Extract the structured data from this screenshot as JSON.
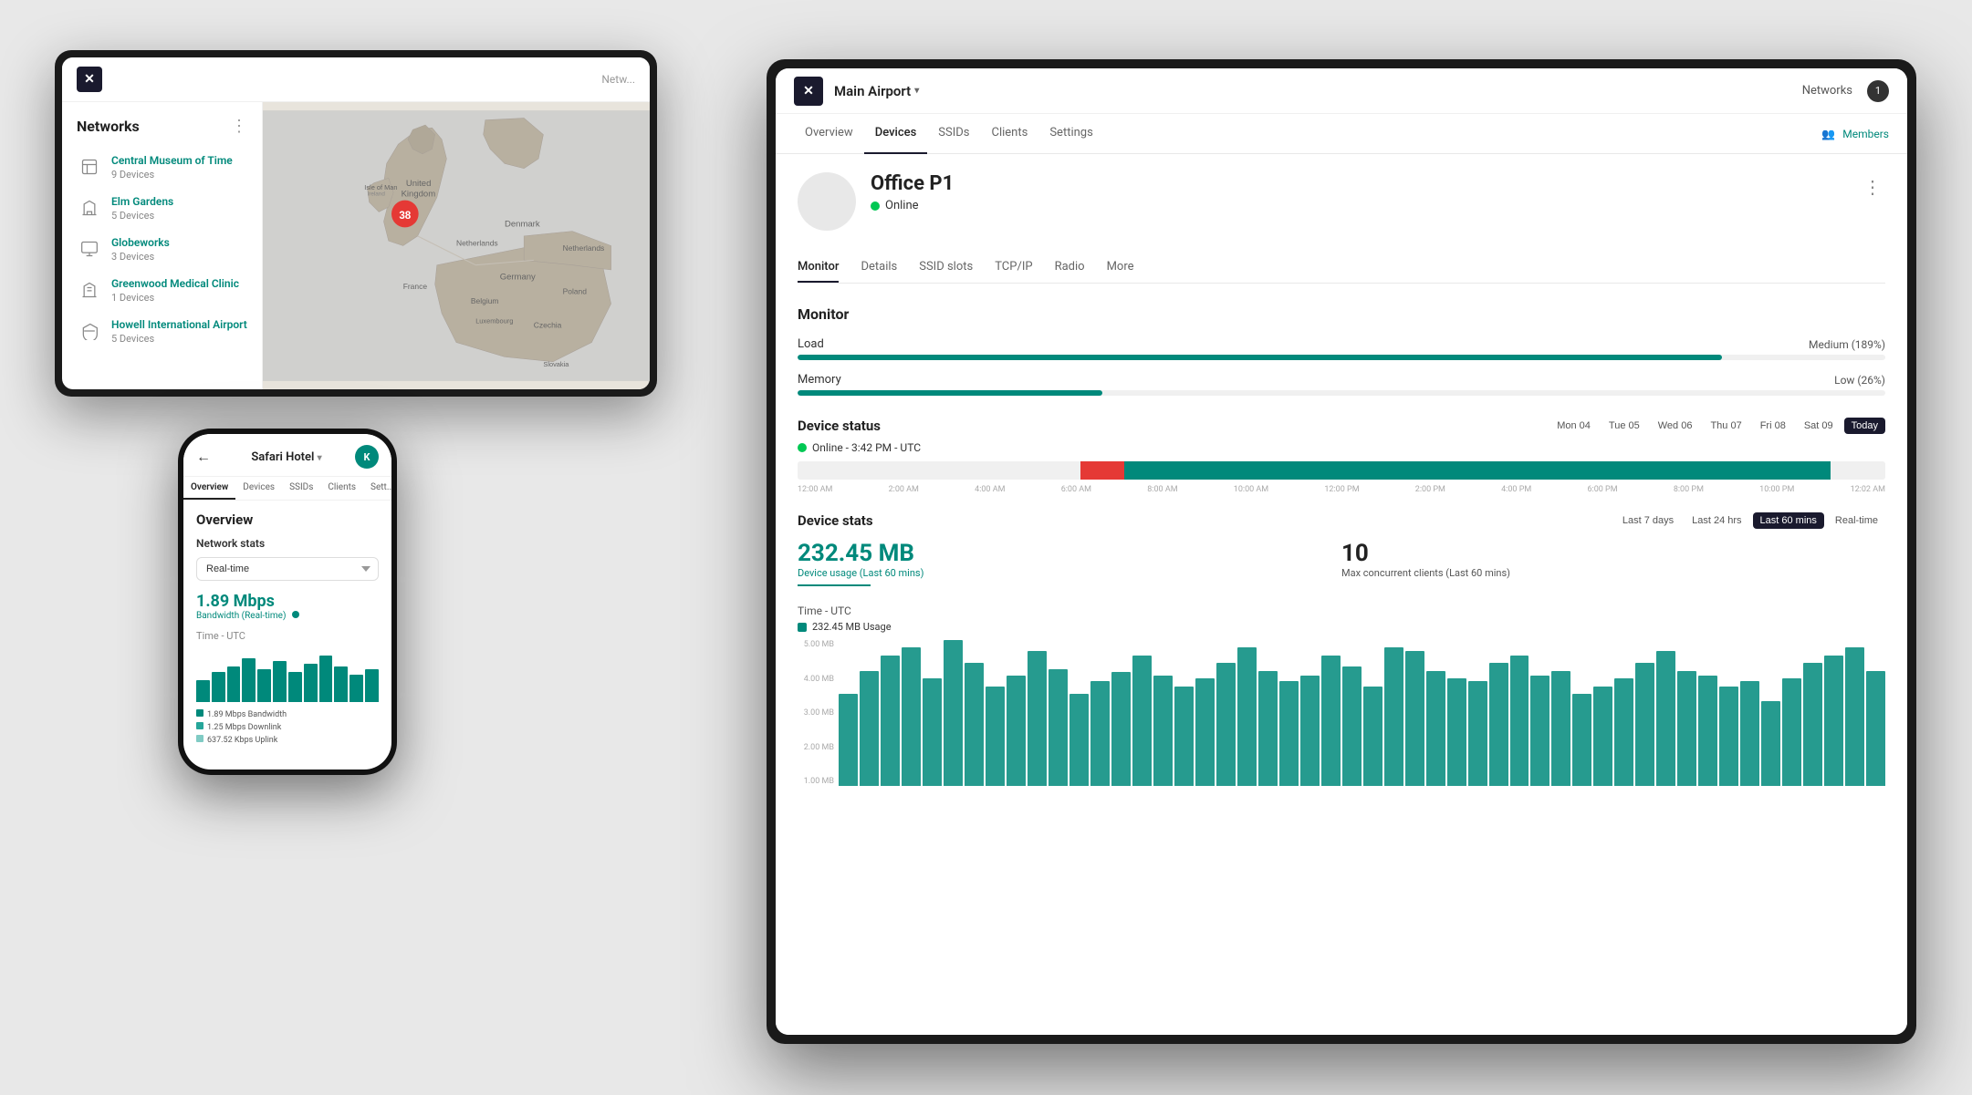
{
  "left_tablet": {
    "logo": "✕",
    "header": {
      "title": "Networks",
      "nav_right": "Netw..."
    },
    "networks": [
      {
        "name": "Central Museum of Time",
        "devices": "9 Devices",
        "icon": "🏛"
      },
      {
        "name": "Elm Gardens",
        "devices": "5 Devices",
        "icon": "🌳"
      },
      {
        "name": "Globeworks",
        "devices": "3 Devices",
        "icon": "🏢"
      },
      {
        "name": "Greenwood Medical Clinic",
        "devices": "1 Devices",
        "icon": "🏥"
      },
      {
        "name": "Howell International Airport",
        "devices": "5 Devices",
        "icon": "✈"
      }
    ],
    "map_pin_count": "38"
  },
  "phone": {
    "header": {
      "back": "←",
      "title": "Safari Hotel",
      "avatar": "K"
    },
    "nav": [
      "Overview",
      "Devices",
      "SSIDs",
      "Clients",
      "Sett..."
    ],
    "active_nav": "Overview",
    "content": {
      "title": "Overview",
      "section": "Network stats",
      "dropdown": "Real-time",
      "bandwidth_value": "1.89 Mbps",
      "bandwidth_label": "Bandwidth (Real-time)",
      "time_label": "Time - UTC",
      "legend": [
        {
          "color": "#00897b",
          "label": "1.89 Mbps Bandwidth"
        },
        {
          "color": "#26a69a",
          "label": "1.25 Mbps Downlink"
        },
        {
          "color": "#80cbc4",
          "label": "637.52 Kbps Uplink"
        }
      ]
    }
  },
  "right_tablet": {
    "logo": "✕",
    "header": {
      "title": "Main Airport",
      "nav_links": [
        "Networks",
        "1"
      ]
    },
    "nav": [
      "Overview",
      "Devices",
      "SSIDs",
      "Clients",
      "Settings"
    ],
    "active_nav": "Overview",
    "members_label": "Members",
    "device": {
      "name": "Office P1",
      "status": "Online",
      "tabs": [
        "Monitor",
        "Details",
        "SSID slots",
        "TCP/IP",
        "Radio",
        "More"
      ],
      "active_tab": "Monitor"
    },
    "monitor": {
      "title": "Monitor",
      "load": {
        "label": "Load",
        "value": "Medium (189%)",
        "percent": 85
      },
      "memory": {
        "label": "Memory",
        "value": "Low (26%)",
        "percent": 28
      }
    },
    "device_status": {
      "title": "Device status",
      "days": [
        "Mon 04",
        "Tue 05",
        "Wed 06",
        "Thu 07",
        "Fri 08",
        "Sat 09",
        "Today"
      ],
      "active_day": "Today",
      "online_text": "Online - 3:42 PM - UTC",
      "timeline_labels": [
        "12:00 AM",
        "2:00 AM",
        "4:00 AM",
        "6:00 AM",
        "8:00 AM",
        "10:00 AM",
        "12:00 PM",
        "2:00 PM",
        "4:00 PM",
        "6:00 PM",
        "8:00 PM",
        "10:00 PM",
        "12:02 AM"
      ]
    },
    "device_stats": {
      "title": "Device stats",
      "time_filters": [
        "Last 7 days",
        "Last 24 hrs",
        "Last 60 mins",
        "Real-time"
      ],
      "active_filter": "Last 60 mins",
      "stat1_value": "232.45 MB",
      "stat1_label": "Device usage (Last 60 mins)",
      "stat2_value": "10",
      "stat2_label": "Max concurrent clients (Last 60 mins)"
    },
    "chart": {
      "title": "Time - UTC",
      "legend_label": "232.45 MB Usage",
      "y_labels": [
        "5.00 MB",
        "4.00 MB",
        "3.00 MB",
        "2.00 MB",
        "1.00 MB"
      ],
      "bars": [
        60,
        75,
        85,
        90,
        70,
        95,
        80,
        65,
        72,
        88,
        76,
        60,
        68,
        74,
        85,
        72,
        65,
        70,
        80,
        90,
        75,
        68,
        72,
        85,
        78,
        65,
        90,
        88,
        75,
        70,
        68,
        80,
        85,
        72,
        75,
        60,
        65,
        70,
        80,
        88,
        75,
        72,
        65,
        68,
        55,
        70,
        80,
        85,
        90,
        75
      ]
    }
  }
}
